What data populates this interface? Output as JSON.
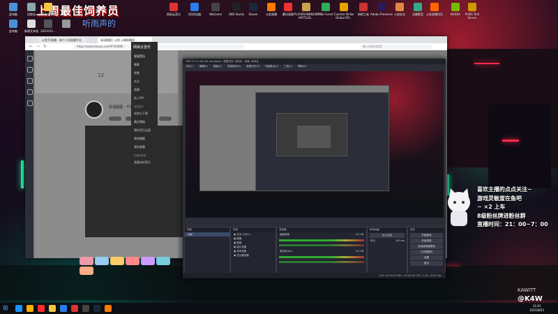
{
  "desktop_top_icons": [
    {
      "label": "此电脑",
      "color": "#4a90d9"
    },
    {
      "label": "回收站",
      "color": "#8aa"
    },
    {
      "label": "上周最佳饲养员",
      "color": "#f4c542"
    },
    {
      "label": "网易云音乐",
      "color": "#d33"
    },
    {
      "label": "QQ浏览器",
      "color": "#2b7de9"
    },
    {
      "label": "WeGame",
      "color": "#444"
    },
    {
      "label": "OBS Studio",
      "color": "#222"
    },
    {
      "label": "Steam",
      "color": "#1b2838"
    },
    {
      "label": "斗鱼直播",
      "color": "#ff7a00"
    },
    {
      "label": "腾讯直播",
      "color": "#e33"
    },
    {
      "label": "PLAYERUNKNOWN'S BATTLEG...",
      "color": "#c9a14a"
    },
    {
      "label": "The Forest",
      "color": "#3a5"
    },
    {
      "label": "Counter-Strike Global Off...",
      "color": "#e6a100"
    },
    {
      "label": "网吧工具",
      "color": "#c33"
    },
    {
      "label": "Adobe Premiere",
      "color": "#2a1a5a"
    },
    {
      "label": "火绒安全",
      "color": "#d84"
    },
    {
      "label": "迅雷影音",
      "color": "#3a8"
    },
    {
      "label": "斗鱼直播伴侣",
      "color": "#f60"
    },
    {
      "label": "NVIDIA",
      "color": "#76b900"
    },
    {
      "label": "PUBG Test Server",
      "color": "#c90"
    }
  ],
  "desktop_left_icons": [
    {
      "label": "此电脑",
      "color": "#4a90d9"
    },
    {
      "label": "新建文本档",
      "color": "#ddd"
    },
    {
      "label": "2021011...",
      "color": "#555"
    },
    {
      "label": "",
      "color": "#999"
    }
  ],
  "banner": {
    "title": "上周最佳饲养员",
    "subtitle": "听雨声的"
  },
  "browser": {
    "tabs": [
      "斗鱼TV直播 - 每个人的直播平台",
      "轻语图图 | 斗鱼 火爆直播间"
    ],
    "url": "https://www.douyu.com/9703880",
    "search_placeholder": "输入关键词搜索",
    "streamer_name": "轻语图图 - 千嗨kdhi.0",
    "viewer_count": "12",
    "gifts": [
      "#e9a",
      "#9ce",
      "#fc6",
      "#f88",
      "#c9f",
      "#7cd",
      "#fa8"
    ]
  },
  "music": {
    "title": "网易云音乐",
    "items": [
      "发现音乐",
      "播客",
      "视频",
      "关注",
      "直播",
      "私人FM"
    ],
    "section": "我的音乐",
    "my_items": [
      "本地与下载",
      "最近播放",
      "我的音乐云盘",
      "我的播客",
      "我的收藏"
    ],
    "playlists_label": "创建的歌单",
    "playlist": "我喜欢的音乐"
  },
  "obs": {
    "title": "OBS 27.0.0 (64-bit, windows) - 配置文件: 未命名 - 场景: 未命名",
    "menu": [
      "文件(F)",
      "编辑(E)",
      "视图(V)",
      "停靠部件(D)",
      "配置文件(P)",
      "场景集合(S)",
      "工具(T)",
      "帮助(H)"
    ],
    "scenes_header": "场景",
    "scenes": [
      "场景"
    ],
    "sources_header": "来源",
    "sources": [
      "文字 (GDI+)",
      "图像",
      "图像",
      "窗口采集",
      "游戏采集",
      "显示器采集"
    ],
    "mixer_header": "混音器",
    "mixer": [
      {
        "name": "桌面音频",
        "level": "0.0 dB"
      },
      {
        "name": "麦克风/Aux",
        "level": "0.0 dB"
      }
    ],
    "transition_header": "转场动画",
    "transition": {
      "type": "淡入淡出",
      "duration_label": "时长",
      "duration": "300 ms"
    },
    "controls_header": "控件",
    "controls": [
      "开始推流",
      "开始录制",
      "启动虚拟摄像机",
      "工作室模式",
      "设置",
      "退出"
    ],
    "status": "LIVE: 00:00:00   REC: 00:00:00   CPU: 2.4%, 60.00 fps"
  },
  "overlay": {
    "lines": [
      "喜欢主播的点点关注~",
      "游戏灵敏度在鱼吧",
      "~ ×2 上车",
      "8级粉丝牌进粉丝群",
      "直播时间：21：00~7：00"
    ]
  },
  "watermark": {
    "small": "KAWITT",
    "big": "@K4W"
  },
  "taskbar": {
    "apps": [
      "#1e90ff",
      "#ffb000",
      "#ff2d2d",
      "#f4c542",
      "#2b7de9",
      "#d33",
      "#444",
      "#1b2838",
      "#ff7a00"
    ],
    "time": "21:01",
    "date": "2021/8/22"
  }
}
